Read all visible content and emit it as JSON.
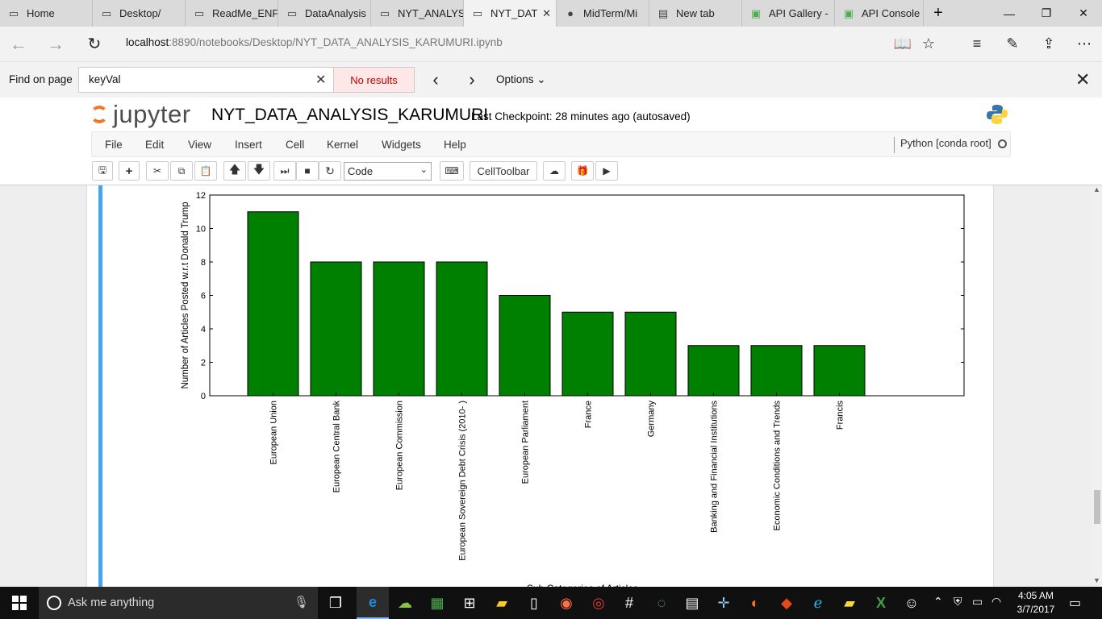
{
  "tabs": [
    {
      "label": "Home",
      "icon": "page-icon"
    },
    {
      "label": "Desktop/",
      "icon": "page-icon"
    },
    {
      "label": "ReadMe_ENF",
      "icon": "page-icon"
    },
    {
      "label": "DataAnalysis",
      "icon": "page-icon"
    },
    {
      "label": "NYT_ANALYS",
      "icon": "page-icon"
    },
    {
      "label": "NYT_DAT",
      "icon": "page-icon",
      "active": true
    },
    {
      "label": "MidTerm/Mi",
      "icon": "github-icon"
    },
    {
      "label": "New tab",
      "icon": "newtab-icon"
    },
    {
      "label": "API Gallery -",
      "icon": "api-icon"
    },
    {
      "label": "API Console",
      "icon": "api-icon"
    }
  ],
  "address": {
    "host": "localhost",
    "rest": ":8890/notebooks/Desktop/NYT_DATA_ANALYSIS_KARUMURI.ipynb"
  },
  "findbar": {
    "label": "Find on page",
    "query": "keyVal",
    "result": "No results",
    "options": "Options"
  },
  "jupyter": {
    "logo": "jupyter",
    "notebook_title": "NYT_DATA_ANALYSIS_KARUMURI",
    "checkpoint": "Last Checkpoint: 28 minutes ago (autosaved)",
    "menus": [
      "File",
      "Edit",
      "View",
      "Insert",
      "Cell",
      "Kernel",
      "Widgets",
      "Help"
    ],
    "kernel": "Python [conda root]",
    "cell_type": "Code",
    "celltoolbar": "CellToolbar"
  },
  "chart_data": {
    "type": "bar",
    "categories": [
      "European Union",
      "European Central Bank",
      "European Commission",
      "European Sovereign Debt Crisis (2010- )",
      "European Parliament",
      "France",
      "Germany",
      "Banking and Financial Institutions",
      "Economic Conditions and Trends",
      "Francis"
    ],
    "values": [
      11,
      8,
      8,
      8,
      6,
      5,
      5,
      3,
      3,
      3
    ],
    "ylabel": "Number of Articles Posted w.r.t Donald Trump",
    "xlabel": "Sub Categories of Articles",
    "ylim": [
      0,
      12
    ],
    "yticks": [
      "0",
      "2",
      "4",
      "6",
      "8",
      "10",
      "12"
    ],
    "bar_color": "#008000"
  },
  "taskbar": {
    "search_placeholder": "Ask me anything",
    "time": "4:05 AM",
    "date": "3/7/2017"
  }
}
